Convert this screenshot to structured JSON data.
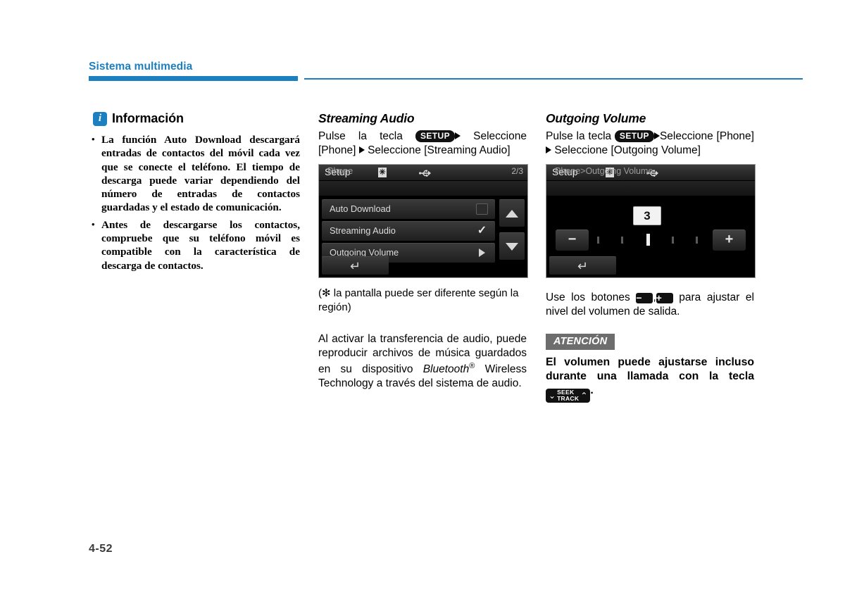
{
  "header": {
    "chapter_title": "Sistema multimedia",
    "accent_color": "#1b7fc0"
  },
  "footer": {
    "page_number": "4-52"
  },
  "left_column": {
    "info_box": {
      "icon": "info-icon",
      "icon_letter": "i",
      "title": "Información",
      "bullets": [
        "La función Auto Download descargará entradas de contactos del móvil cada vez que se conecte el teléfono. El tiempo de descarga puede variar dependiendo del número de entradas de contactos guardadas y el estado de comunicación.",
        "Antes de descargarse los contactos, compruebe que su teléfono móvil es compatible con la característica de descarga de contactos."
      ]
    }
  },
  "middle_column": {
    "heading": "Streaming Audio",
    "instruction": {
      "part1": "Pulse la tecla",
      "key": "SETUP",
      "part2": "Seleccione [Phone]",
      "part3": "Seleccione [Streaming Audio]"
    },
    "device_screen": {
      "title": "Setup",
      "bluetooth_icon": "bluetooth-icon",
      "usb_icon": "usb-icon",
      "breadcrumb": "Phone",
      "page_indicator": "2/3",
      "rows": [
        {
          "label": "Auto Download",
          "control": "checkbox-empty"
        },
        {
          "label": "Streaming Audio",
          "control": "checkbox-checked"
        },
        {
          "label": "Outgoing Volume",
          "control": "arrow-right"
        }
      ],
      "scroll_up": "scroll-up-button",
      "scroll_down": "scroll-down-button",
      "back_button": "back-button"
    },
    "caption": "(✻ la pantalla puede ser diferente según la región)",
    "body": {
      "line1": "Al activar la transferencia de audio, puede reproducir archivos de música guardados en su dispositivo ",
      "brand": "Bluetooth",
      "registered": "®",
      "line2": " Wireless Technology a través del sistema de audio."
    }
  },
  "right_column": {
    "heading": "Outgoing Volume",
    "instruction": {
      "part1": "Pulse la tecla",
      "key": "SETUP",
      "part2": "Seleccione [Phone]",
      "part3": "Seleccione [Outgoing Volume]"
    },
    "device_screen": {
      "title": "Setup",
      "bluetooth_icon": "bluetooth-icon",
      "usb_icon": "usb-icon",
      "breadcrumb": "Phone>Outgoing Volume",
      "value": "3",
      "minus_label": "−",
      "plus_label": "+",
      "tick_count": 5,
      "active_tick": 3,
      "back_button": "back-button"
    },
    "body": {
      "part1": "Use los botones",
      "minus": "−",
      "comma": ",",
      "plus": "+",
      "part2": "para ajustar el nivel del volumen de salida."
    },
    "warning": {
      "badge": "ATENCIÓN",
      "text_part1": "El volumen puede ajustarse incluso durante una llamada con la tecla",
      "key_line1": "SEEK",
      "key_line2": "TRACK",
      "chevron_left": "⌄",
      "chevron_right": "⌃",
      "period": "."
    }
  }
}
